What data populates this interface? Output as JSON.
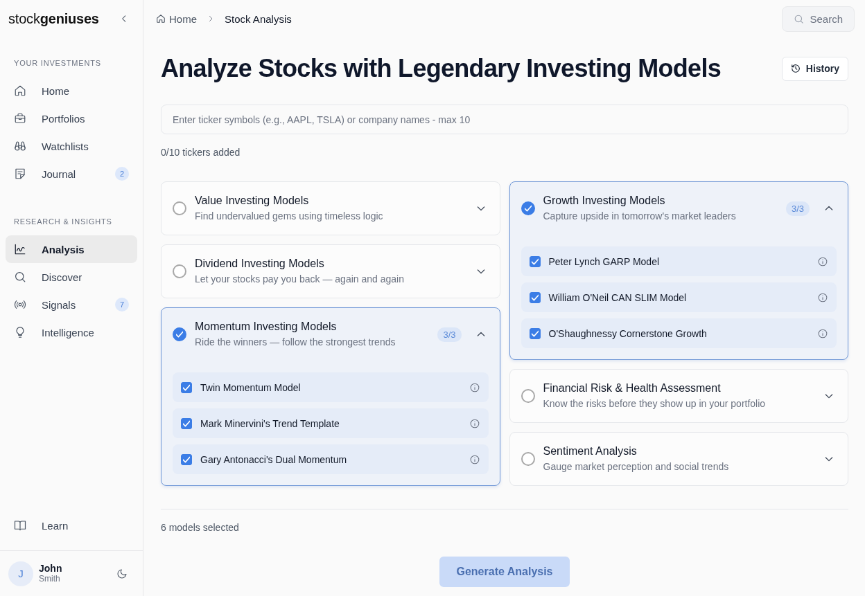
{
  "sidebar": {
    "logo": "stock**geniuses**",
    "sections": [
      {
        "heading": "YOUR INVESTMENTS",
        "items": [
          {
            "label": "Home",
            "selected": false
          },
          {
            "label": "Portfolios",
            "selected": false
          },
          {
            "label": "Watchlists",
            "selected": false
          },
          {
            "label": "Journal",
            "selected": false,
            "badge": "2"
          }
        ]
      },
      {
        "heading": "RESEARCH & INSIGHTS",
        "items": [
          {
            "label": "Analysis",
            "selected": true
          },
          {
            "label": "Discover",
            "selected": false
          },
          {
            "label": "Signals",
            "selected": false,
            "badge": "7"
          },
          {
            "label": "Intelligence",
            "selected": false
          }
        ]
      }
    ],
    "footer_items": [
      {
        "label": "Learn",
        "selected": false
      }
    ],
    "user": {
      "initial": "J",
      "first_name": "John",
      "last_name": "Smith"
    }
  },
  "breadcrumb": [
    {
      "label": "Home"
    },
    {
      "label": "Stock Analysis"
    }
  ],
  "search_button": {
    "label": "Search"
  },
  "page_title": "Analyze Stocks with Legendary Investing Models",
  "history_button": {
    "label": "History"
  },
  "ticker_input": {
    "placeholder": "Enter ticker symbols (e.g., AAPL, TSLA) or company names - max 10",
    "counter": "0/10 tickers added"
  },
  "model_columns": [
    {
      "groups": [
        {
          "title": "Value Investing Models",
          "subtitle": "Find undervalued gems using timeless logic",
          "checked": false,
          "expanded": false
        },
        {
          "title": "Dividend Investing Models",
          "subtitle": "Let your stocks pay you back — again and again",
          "checked": false,
          "expanded": false
        },
        {
          "title": "Momentum Investing Models",
          "subtitle": "Ride the winners — follow the strongest trends",
          "checked": true,
          "expanded": true,
          "count": "3/3",
          "models": [
            {
              "label": "Twin Momentum Model",
              "checked": true
            },
            {
              "label": "Mark Minervini's Trend Template",
              "checked": true
            },
            {
              "label": "Gary Antonacci's Dual Momentum",
              "checked": true
            }
          ]
        }
      ]
    },
    {
      "groups": [
        {
          "title": "Growth Investing Models",
          "subtitle": "Capture upside in tomorrow's market leaders",
          "checked": true,
          "expanded": true,
          "count": "3/3",
          "models": [
            {
              "label": "Peter Lynch GARP Model",
              "checked": true
            },
            {
              "label": "William O'Neil CAN SLIM Model",
              "checked": true
            },
            {
              "label": "O'Shaughnessy Cornerstone Growth",
              "checked": true
            }
          ]
        },
        {
          "title": "Financial Risk & Health Assessment",
          "subtitle": "Know the risks before they show up in your portfolio",
          "checked": false,
          "expanded": false
        },
        {
          "title": "Sentiment Analysis",
          "subtitle": "Gauge market perception and social trends",
          "checked": false,
          "expanded": false
        }
      ]
    }
  ],
  "selection_summary": "6 models selected",
  "generate_button": {
    "label": "Generate Analysis",
    "disabled": true
  }
}
